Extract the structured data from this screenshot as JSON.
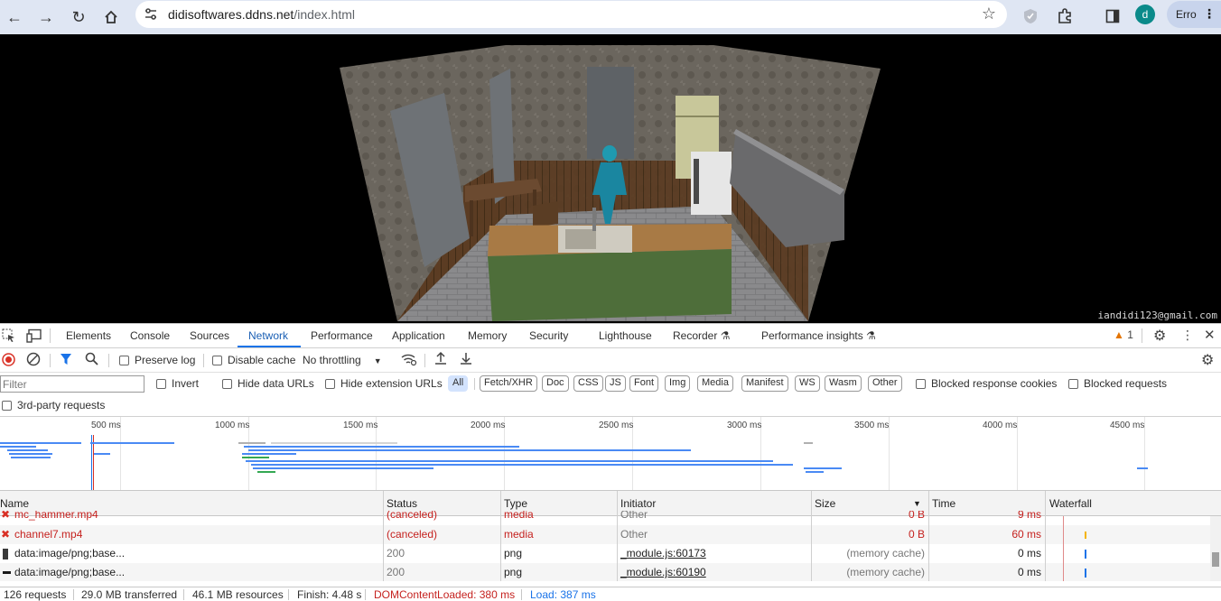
{
  "browser": {
    "url_host": "didisoftwares.ddns.net",
    "url_path": "/index.html",
    "profile_initial": "d",
    "error_label": "Erro"
  },
  "viewport": {
    "email": "iandidi123@gmail.com"
  },
  "devtools": {
    "tabs": [
      "Elements",
      "Console",
      "Sources",
      "Network",
      "Performance",
      "Application",
      "Memory",
      "Security",
      "Lighthouse",
      "Recorder",
      "Performance insights"
    ],
    "active_tab": "Network",
    "warning_count": "1",
    "toolbar": {
      "preserve_log": "Preserve log",
      "disable_cache": "Disable cache",
      "throttling": "No throttling"
    },
    "filter": {
      "placeholder": "Filter",
      "invert": "Invert",
      "hide_data_urls": "Hide data URLs",
      "hide_extension_urls": "Hide extension URLs",
      "types": [
        "All",
        "Fetch/XHR",
        "Doc",
        "CSS",
        "JS",
        "Font",
        "Img",
        "Media",
        "Manifest",
        "WS",
        "Wasm",
        "Other"
      ],
      "blocked_cookies": "Blocked response cookies",
      "blocked_requests": "Blocked requests",
      "third_party": "3rd-party requests"
    },
    "overview_ticks": [
      "500 ms",
      "1000 ms",
      "1500 ms",
      "2000 ms",
      "2500 ms",
      "3000 ms",
      "3500 ms",
      "4000 ms",
      "4500 ms"
    ],
    "columns": [
      "Name",
      "Status",
      "Type",
      "Initiator",
      "Size",
      "Time",
      "Waterfall"
    ],
    "rows": [
      {
        "name": "mc_hammer.mp4",
        "status": "(canceled)",
        "type": "media",
        "initiator": "Other",
        "size": "0 B",
        "time": "9 ms"
      },
      {
        "name": "channel7.mp4",
        "status": "(canceled)",
        "type": "media",
        "initiator": "Other",
        "size": "0 B",
        "time": "60 ms"
      },
      {
        "name": "data:image/png;base...",
        "status": "200",
        "type": "png",
        "initiator": "_module.js:60173",
        "size": "(memory cache)",
        "time": "0 ms"
      },
      {
        "name": "data:image/png;base...",
        "status": "200",
        "type": "png",
        "initiator": "_module.js:60190",
        "size": "(memory cache)",
        "time": "0 ms"
      }
    ],
    "status": {
      "requests": "126 requests",
      "transferred": "29.0 MB transferred",
      "resources": "46.1 MB resources",
      "finish": "Finish: 4.48 s",
      "dom": "DOMContentLoaded: 380 ms",
      "load": "Load: 387 ms"
    }
  }
}
